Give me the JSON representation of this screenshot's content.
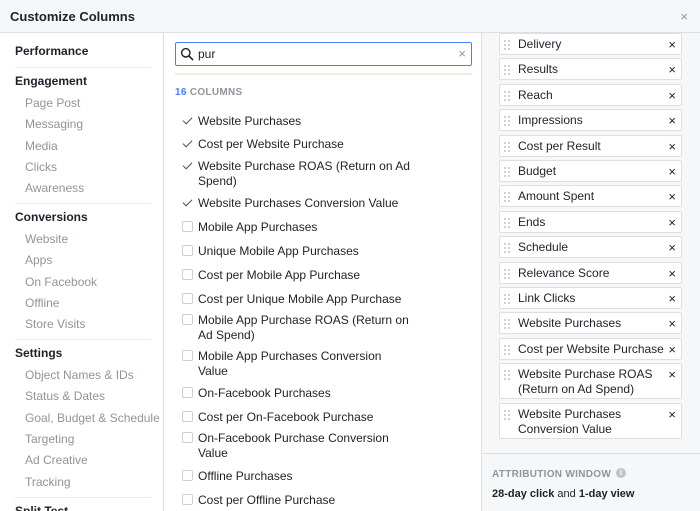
{
  "dialog": {
    "title": "Customize Columns",
    "close": "×"
  },
  "nav": {
    "sections": [
      {
        "heading": "Performance",
        "items": []
      },
      {
        "heading": "Engagement",
        "items": [
          "Page Post",
          "Messaging",
          "Media",
          "Clicks",
          "Awareness"
        ]
      },
      {
        "heading": "Conversions",
        "items": [
          "Website",
          "Apps",
          "On Facebook",
          "Offline",
          "Store Visits"
        ]
      },
      {
        "heading": "Settings",
        "items": [
          "Object Names & IDs",
          "Status & Dates",
          "Goal, Budget & Schedule",
          "Targeting",
          "Ad Creative",
          "Tracking"
        ]
      },
      {
        "heading": "Split Test",
        "items": []
      }
    ]
  },
  "search": {
    "value": "pur",
    "clear": "×"
  },
  "columns_count": {
    "number": "16",
    "label": "COLUMNS"
  },
  "options": [
    {
      "label": "Website Purchases",
      "checked": true
    },
    {
      "label": "Cost per Website Purchase",
      "checked": true
    },
    {
      "label": "Website Purchase ROAS (Return on Ad Spend)",
      "checked": true
    },
    {
      "label": "Website Purchases Conversion Value",
      "checked": true
    },
    {
      "label": "Mobile App Purchases",
      "checked": false
    },
    {
      "label": "Unique Mobile App Purchases",
      "checked": false
    },
    {
      "label": "Cost per Mobile App Purchase",
      "checked": false
    },
    {
      "label": "Cost per Unique Mobile App Purchase",
      "checked": false
    },
    {
      "label": "Mobile App Purchase ROAS (Return on Ad Spend)",
      "checked": false
    },
    {
      "label": "Mobile App Purchases Conversion Value",
      "checked": false
    },
    {
      "label": "On-Facebook Purchases",
      "checked": false
    },
    {
      "label": "Cost per On-Facebook Purchase",
      "checked": false
    },
    {
      "label": "On-Facebook Purchase Conversion Value",
      "checked": false
    },
    {
      "label": "Offline Purchases",
      "checked": false
    },
    {
      "label": "Cost per Offline Purchase",
      "checked": false
    }
  ],
  "selected_columns": [
    "Delivery",
    "Results",
    "Reach",
    "Impressions",
    "Cost per Result",
    "Budget",
    "Amount Spent",
    "Ends",
    "Schedule",
    "Relevance Score",
    "Link Clicks",
    "Website Purchases",
    "Cost per Website Purchase",
    "Website Purchase ROAS (Return on Ad Spend)",
    "Website Purchases Conversion Value"
  ],
  "remove_glyph": "×",
  "attribution": {
    "title": "ATTRIBUTION WINDOW",
    "info": "i",
    "click": "28-day click",
    "and": " and ",
    "view": "1-day view"
  },
  "colors": {
    "accent": "#4080ff",
    "muted": "#90949c",
    "panel": "#f6f7f9"
  }
}
